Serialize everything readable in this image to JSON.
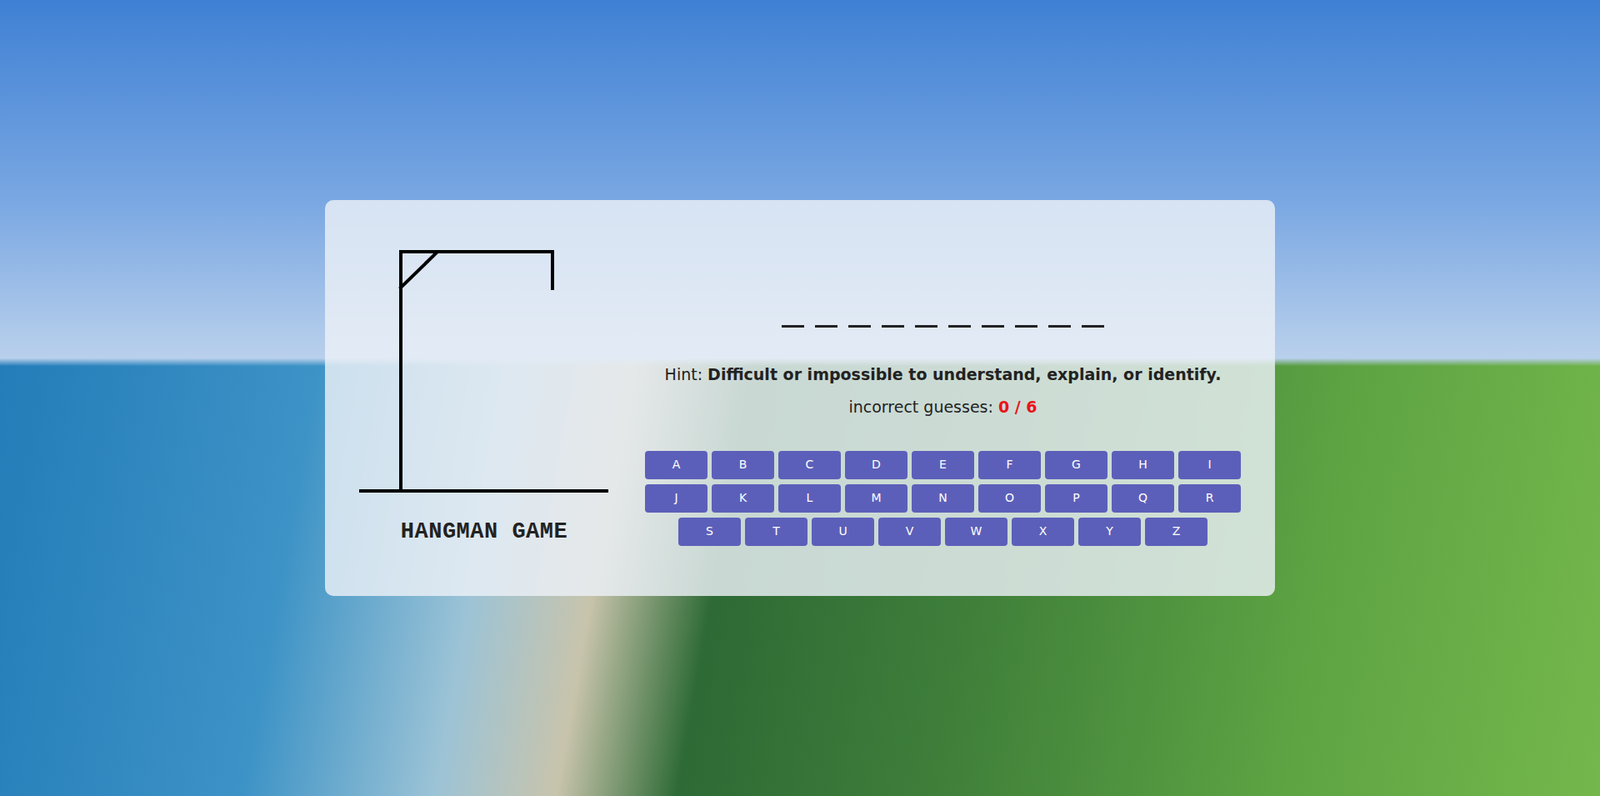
{
  "title": "HANGMAN GAME",
  "word": {
    "slots": [
      {
        "revealed": false
      },
      {
        "revealed": false
      },
      {
        "revealed": false
      },
      {
        "revealed": false
      },
      {
        "revealed": false
      },
      {
        "revealed": false
      },
      {
        "revealed": false
      },
      {
        "revealed": false
      },
      {
        "revealed": false
      },
      {
        "revealed": false
      }
    ]
  },
  "hint": {
    "label": "Hint:",
    "text": "Difficult or impossible to understand, explain, or identify."
  },
  "guesses": {
    "label": "incorrect guesses:",
    "count": "0 / 6"
  },
  "keyboard": {
    "rows": [
      [
        {
          "label": "A",
          "disabled": false
        },
        {
          "label": "B",
          "disabled": false
        },
        {
          "label": "C",
          "disabled": false
        },
        {
          "label": "D",
          "disabled": false
        },
        {
          "label": "E",
          "disabled": false
        },
        {
          "label": "F",
          "disabled": false
        },
        {
          "label": "G",
          "disabled": false
        },
        {
          "label": "H",
          "disabled": false
        },
        {
          "label": "I",
          "disabled": false
        }
      ],
      [
        {
          "label": "J",
          "disabled": false
        },
        {
          "label": "K",
          "disabled": false
        },
        {
          "label": "L",
          "disabled": false
        },
        {
          "label": "M",
          "disabled": false
        },
        {
          "label": "N",
          "disabled": false
        },
        {
          "label": "O",
          "disabled": false
        },
        {
          "label": "P",
          "disabled": false
        },
        {
          "label": "Q",
          "disabled": false
        },
        {
          "label": "R",
          "disabled": false
        }
      ],
      [
        {
          "label": "S",
          "disabled": false
        },
        {
          "label": "T",
          "disabled": false
        },
        {
          "label": "U",
          "disabled": false
        },
        {
          "label": "V",
          "disabled": false
        },
        {
          "label": "W",
          "disabled": false
        },
        {
          "label": "X",
          "disabled": false
        },
        {
          "label": "Y",
          "disabled": false
        },
        {
          "label": "Z",
          "disabled": false
        }
      ]
    ]
  }
}
